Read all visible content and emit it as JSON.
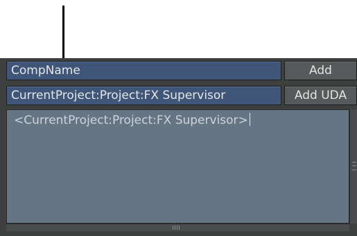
{
  "name_field": {
    "value": "CompName"
  },
  "add_button": {
    "label": "Add"
  },
  "uda_field": {
    "value": "CurrentProject:Project:FX Supervisor"
  },
  "add_uda_button": {
    "label": "Add UDA"
  },
  "editor": {
    "text": "<CurrentProject:Project:FX Supervisor>"
  },
  "colors": {
    "panel": "#3e4040",
    "field": "#3f5678",
    "button": "#565a5a",
    "editor": "#667584"
  },
  "icons": {
    "annotation": "down-arrow-icon",
    "vscroll_grip": "grip-icon",
    "hscroll_grip": "grip-icon"
  }
}
